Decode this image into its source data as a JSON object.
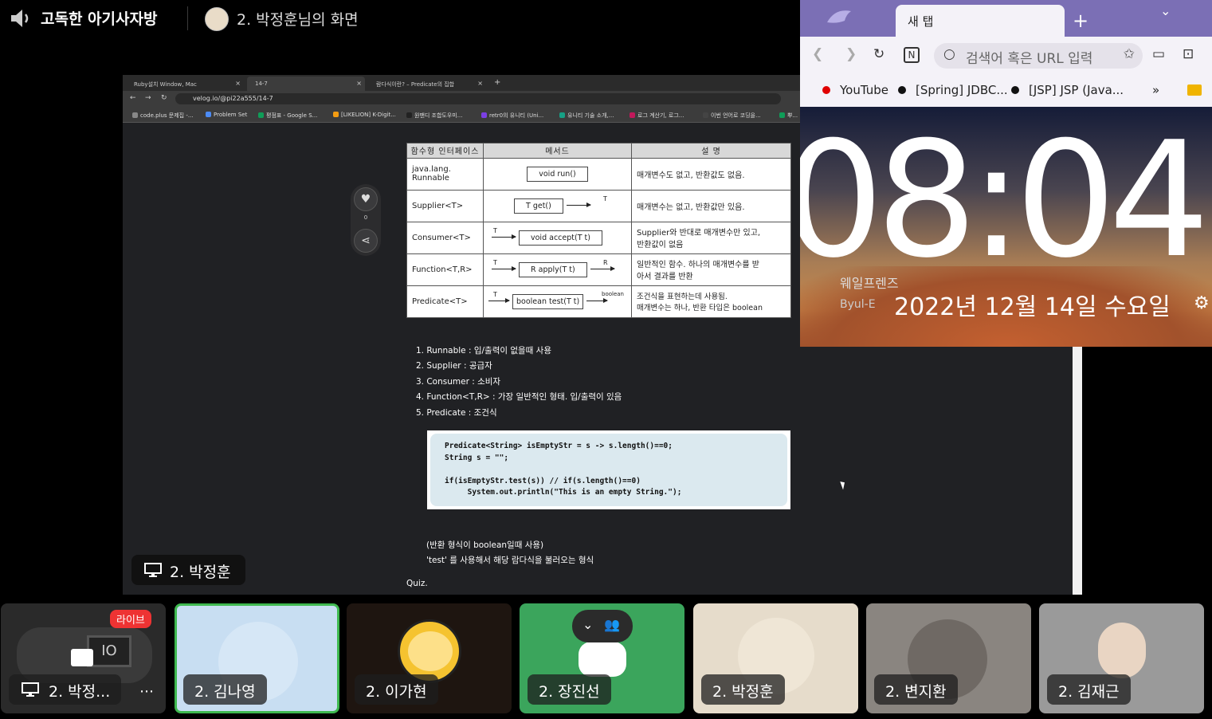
{
  "header": {
    "room_title": "고독한 아기사자방",
    "sharer_title": "2. 박정훈님의 화면"
  },
  "shared_browser": {
    "tabs": [
      {
        "label": "Ruby설치 Window, Mac",
        "close": "×"
      },
      {
        "label": "14-7",
        "close": "×"
      },
      {
        "label": "람다식이란? – Predicate의 집합",
        "close": "×"
      }
    ],
    "new_tab": "+",
    "url": "velog.io/@pi22a555/14-7",
    "bookmarks": [
      "code.plus 문제집 -...",
      "Problem Set",
      "평점표 - Google S...",
      "[LIKELION] K-Digit...",
      "원팬디 조합도우미...",
      "retr0의 유니티 (Uni...",
      "유니티 기술 소개,...",
      "로그 계산기, 로그...",
      "이번 언어로 코딩을...",
      "뿌..."
    ],
    "like_count": "0",
    "table": {
      "headers": [
        "함수형 인터페이스",
        "메서드",
        "설 명"
      ],
      "rows": [
        {
          "iface": "java.lang.\nRunnable",
          "method": "void run()",
          "in": "",
          "out": "",
          "desc": "매개변수도 없고, 반환값도 없음."
        },
        {
          "iface": "Supplier<T>",
          "method": "T get()",
          "in": "",
          "out": "T",
          "desc": "매개변수는 없고, 반환값만 있음."
        },
        {
          "iface": "Consumer<T>",
          "method": "void accept(T t)",
          "in": "T",
          "out": "",
          "desc": "Supplier와 반대로 매개변수만 있고,\n반환값이 없음"
        },
        {
          "iface": "Function<T,R>",
          "method": "R apply(T t)",
          "in": "T",
          "out": "R",
          "desc": "일반적인 함수. 하나의 매개변수를 받\n아서 결과를 반환"
        },
        {
          "iface": "Predicate<T>",
          "method": "boolean test(T t)",
          "in": "T",
          "out": "boolean",
          "desc": "조건식을 표현하는데 사용됨.\n매개변수는 하나, 반환 타입은 boolean"
        }
      ]
    },
    "list": [
      "1. Runnable : 입/출력이 없을때 사용",
      "2. Supplier : 공급자",
      "3. Consumer : 소비자",
      "4. Function<T,R> : 가장 일반적인 형태. 입/출력이 있음",
      "5. Predicate : 조건식"
    ],
    "code": "Predicate<String> isEmptyStr = s -> s.length()==0;\nString s = \"\";\n\nif(isEmptyStr.test(s)) // if(s.length()==0)\n     System.out.println(\"This is an empty String.\");",
    "note1": "(반환 형식이 boolean일때 사용)",
    "note2": "'test' 를 사용해서 해당 람다식을 불러오는 형식",
    "quiz": "Quiz."
  },
  "presenter_label": "2. 박정훈",
  "new_tab_page": {
    "tab_title": "새 탭",
    "omnibox_placeholder": "검색어 혹은 URL 입력",
    "bookmarks": [
      {
        "label": "YouTube",
        "color": "#e00000"
      },
      {
        "label": "[Spring] JDBC...",
        "color": "#111111"
      },
      {
        "label": "[JSP] JSP (Java...",
        "color": "#111111"
      }
    ],
    "more_bookmarks": "»",
    "clock": "08:04",
    "brand": "웨일프렌즈",
    "brand_sub": "Byul-E",
    "date": "2022년 12월 14일 수요일"
  },
  "participants": [
    {
      "name": "2. 박정...",
      "badge": "라이브",
      "bg": "#2a2a2a"
    },
    {
      "name": "2. 김나영",
      "bg": "#c8def2"
    },
    {
      "name": "2. 이가현",
      "bg": "#1e1510"
    },
    {
      "name": "2. 장진선",
      "bg": "#3ba55c"
    },
    {
      "name": "2. 박정훈",
      "bg": "#e6dccb"
    },
    {
      "name": "2. 변지환",
      "bg": "#8a8580"
    },
    {
      "name": "2. 김재근",
      "bg": "#9a9a9a"
    }
  ],
  "more_label": "⋯"
}
